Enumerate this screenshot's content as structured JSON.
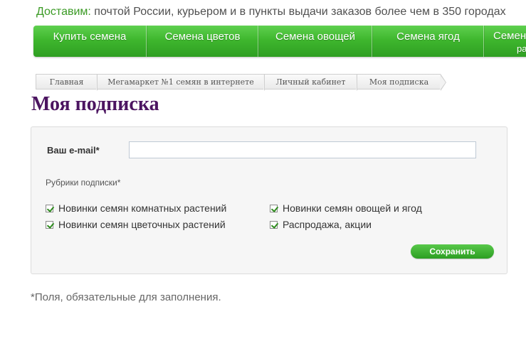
{
  "delivery": {
    "highlight": "Доставим:",
    "text": "почтой России, курьером и в пункты выдачи заказов более чем в 350 городах"
  },
  "nav": {
    "items": [
      {
        "label": "Купить семена"
      },
      {
        "label": "Семена цветов"
      },
      {
        "label": "Семена овощей"
      },
      {
        "label": "Семена ягод"
      },
      {
        "label": "Семена",
        "label_line2": "ра"
      }
    ]
  },
  "breadcrumb": [
    {
      "label": "Главная"
    },
    {
      "label": "Мегамаркет №1 семян в интернете"
    },
    {
      "label": "Личный кабинет"
    },
    {
      "label": "Моя подписка"
    }
  ],
  "page": {
    "title": "Моя подписка"
  },
  "form": {
    "email_label": "Ваш e-mail*",
    "email_value": "",
    "rubrics_label": "Рубрики подписки*",
    "checkboxes": [
      {
        "label": "Новинки семян комнатных растений",
        "checked": true
      },
      {
        "label": "Новинки семян овощей и ягод",
        "checked": true
      },
      {
        "label": "Новинки семян цветочных растений",
        "checked": true
      },
      {
        "label": "Распродажа, акции",
        "checked": true
      }
    ],
    "save_label": "Сохранить"
  },
  "footnote": "*Поля, обязательные для заполнения.",
  "colors": {
    "nav_green": "#3fb72e",
    "title_purple": "#4c1561",
    "delivery_green": "#3a9a24",
    "button_green": "#2c9e22"
  }
}
